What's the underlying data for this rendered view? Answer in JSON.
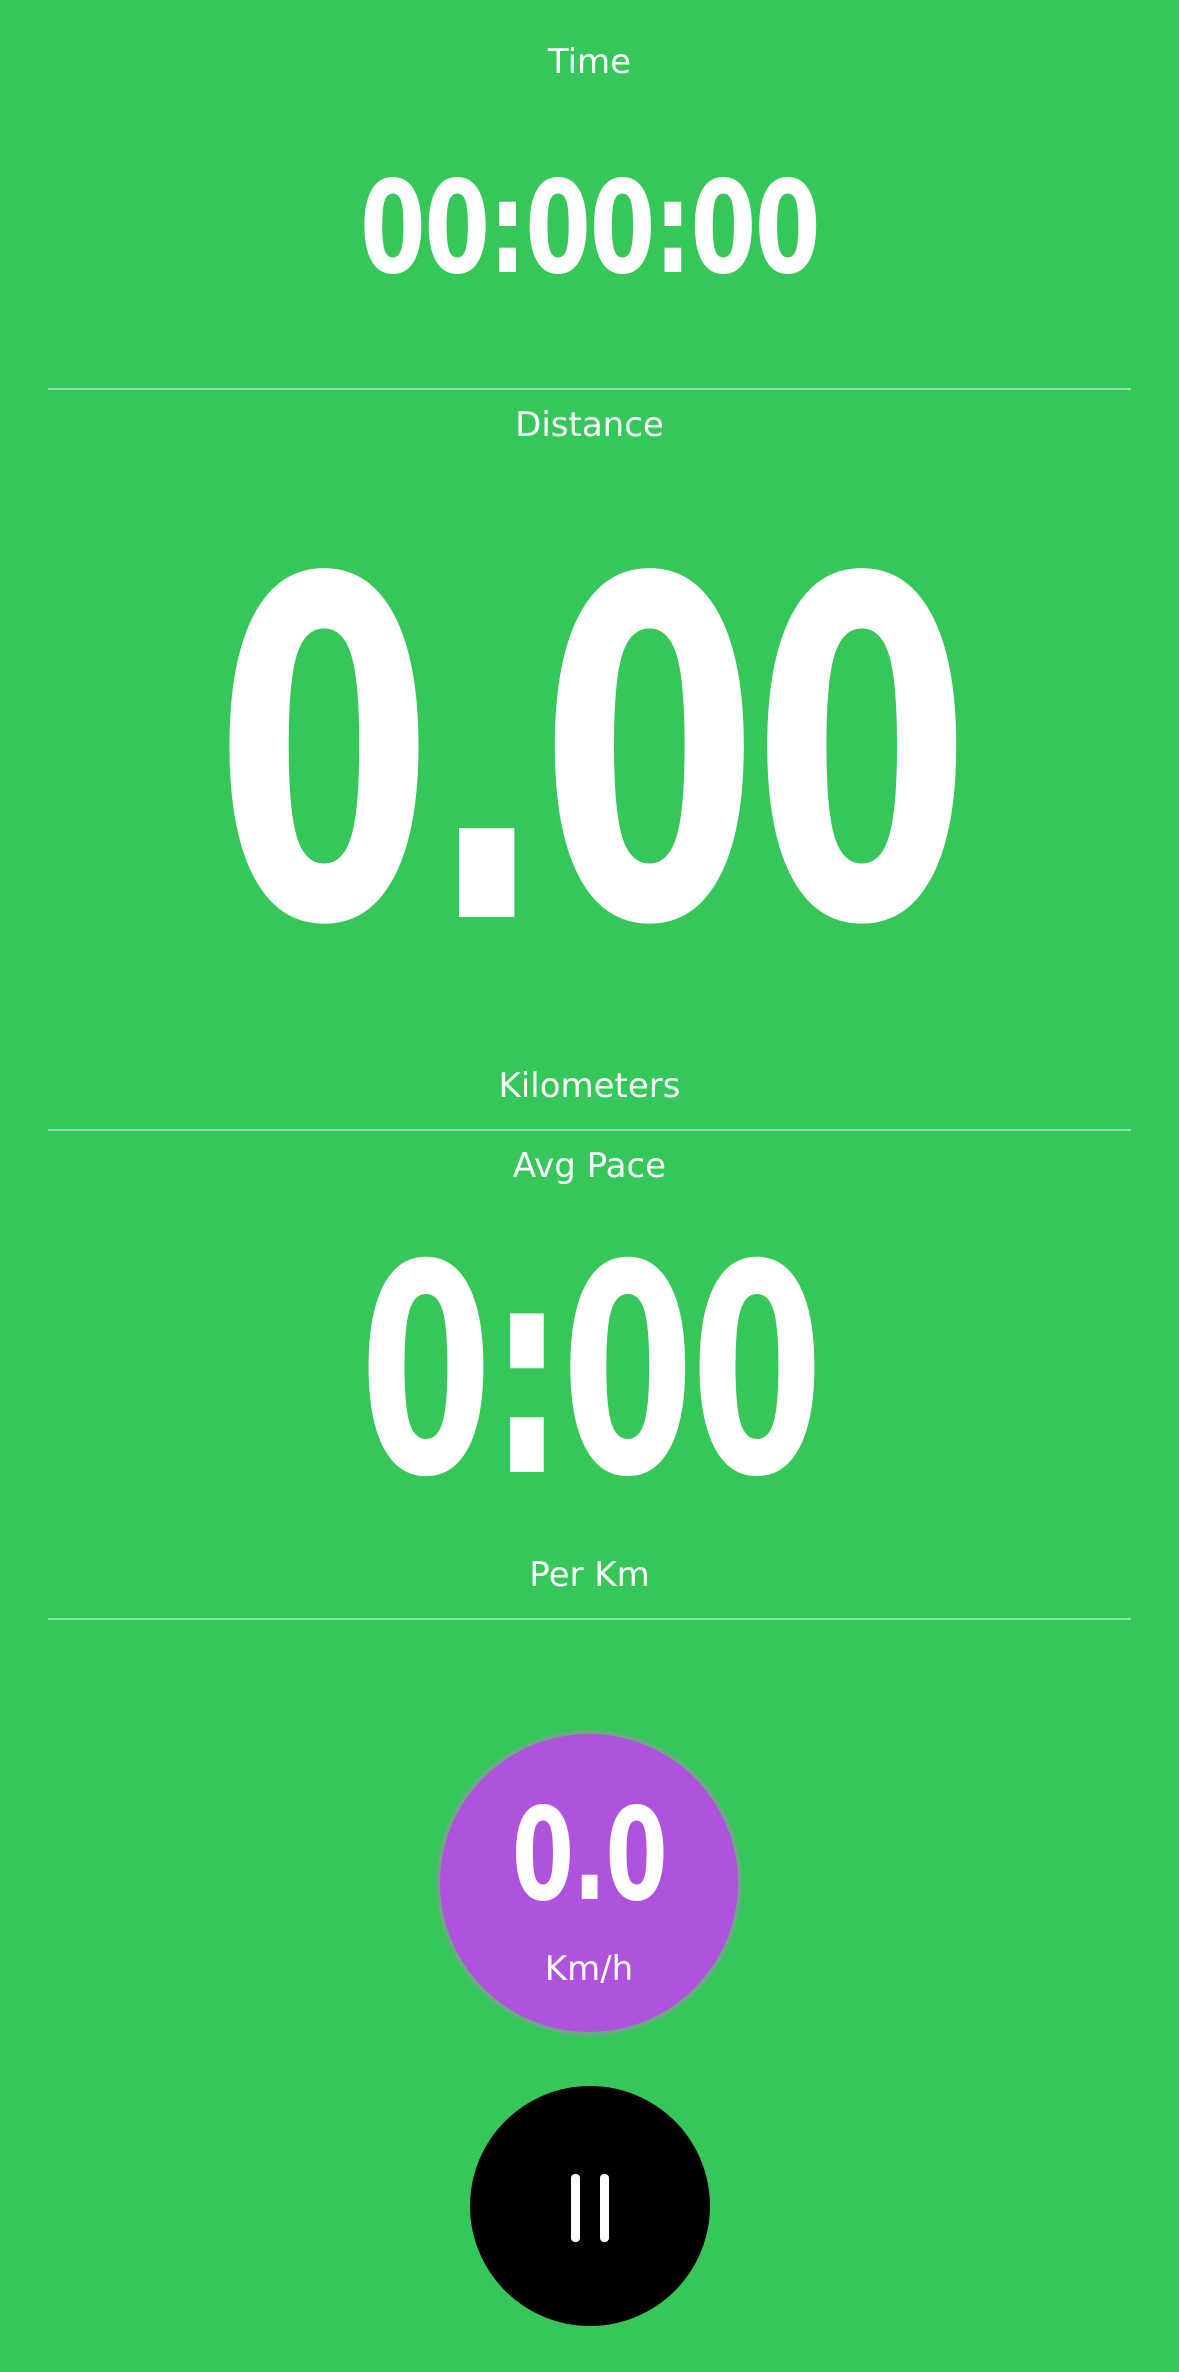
{
  "time": {
    "label": "Time",
    "value": "00:00:00"
  },
  "distance": {
    "label": "Distance",
    "value": "0.00",
    "unit": "Kilometers"
  },
  "pace": {
    "label": "Avg Pace",
    "value": "0:00",
    "unit": "Per Km"
  },
  "speed": {
    "value": "0.0",
    "unit": "Km/h"
  },
  "controls": {
    "pause_icon": "pause-icon"
  },
  "colors": {
    "background": "#36c75b",
    "speed_circle": "#af52de",
    "pause_button": "#000000",
    "text": "#ffffff"
  }
}
